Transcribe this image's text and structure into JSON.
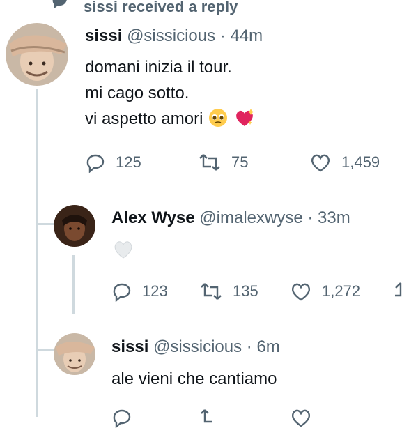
{
  "header": {
    "text": "sissi received a reply",
    "icon": "speech-bubble-icon"
  },
  "tweet1": {
    "name": "sissi",
    "handle": "@sissicious",
    "time": "· 44m",
    "lines": [
      "domani inizia il tour.",
      "mi cago sotto.",
      "vi aspetto amori"
    ],
    "emojis": [
      "pleading-face-icon",
      "sparkling-heart-icon"
    ],
    "replies": "125",
    "retweets": "75",
    "likes": "1,459"
  },
  "tweet2": {
    "name": "Alex Wyse",
    "handle": "@imalexwyse",
    "time": "· 33m",
    "emoji": "white-heart-icon",
    "replies": "123",
    "retweets": "135",
    "likes": "1,272"
  },
  "tweet3": {
    "name": "sissi",
    "handle": "@sissicious",
    "time": "· 6m",
    "text": "ale vieni che cantiamo"
  },
  "colors": {
    "muted": "#536471",
    "line": "#cfd9de",
    "heart": "#e0245e"
  }
}
